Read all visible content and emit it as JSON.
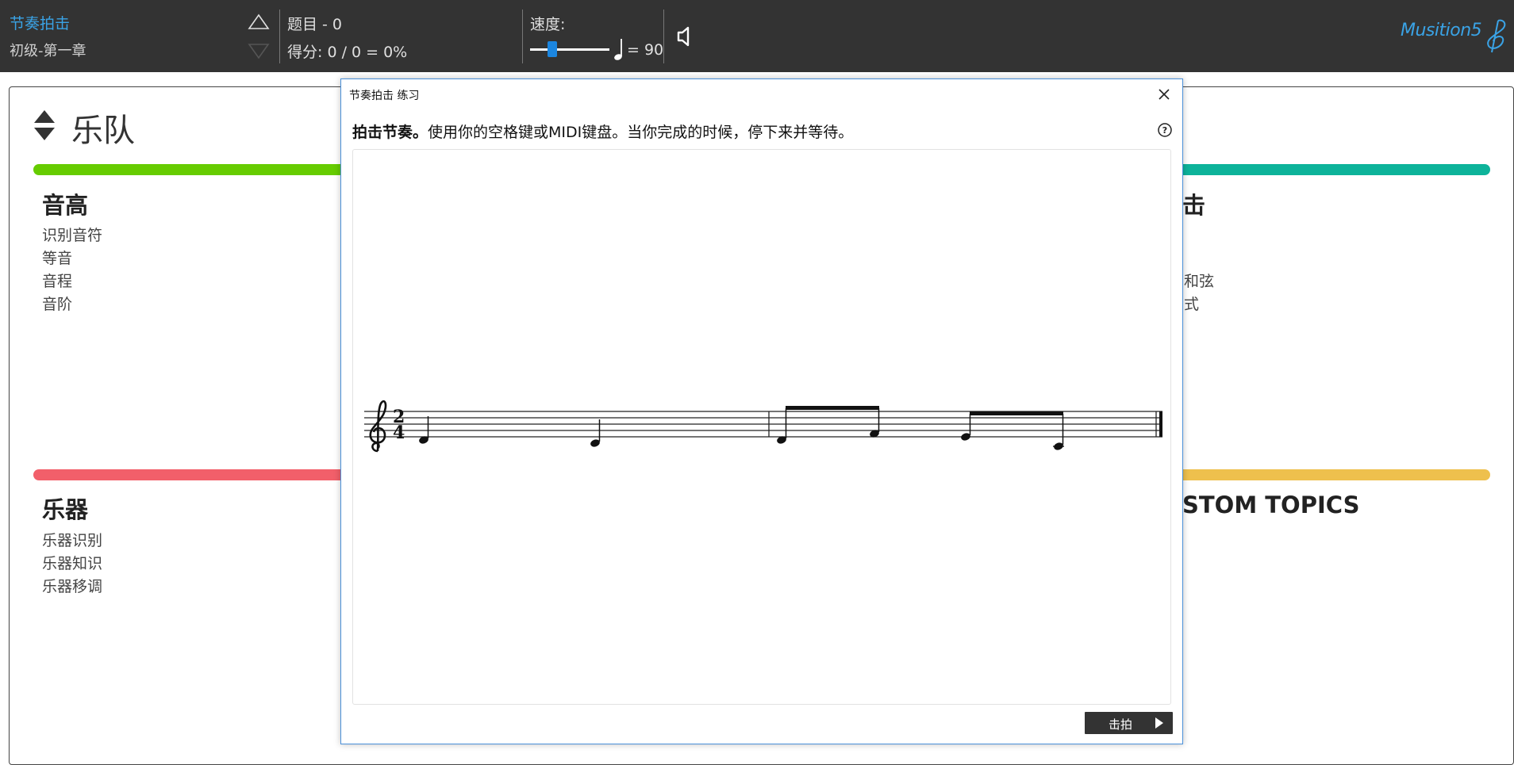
{
  "topbar": {
    "exercise_title": "节奏拍击",
    "exercise_subtitle": "初级-第一章",
    "question_label": "题目 - 0",
    "score_label": "得分: 0 / 0 = 0%",
    "tempo_label": "速度:",
    "tempo_value": "= 90",
    "tempo_slider_fraction": 0.25,
    "brand": "Musition5"
  },
  "background": {
    "ensemble_title": "乐队",
    "categories": [
      {
        "head": "音高",
        "color": "#66cc00",
        "items": [
          "识别音符",
          "等音",
          "音程",
          "音阶"
        ]
      },
      {
        "head": "击",
        "color": "#0db39a",
        "items": [
          "",
          "",
          "和弦",
          "式"
        ]
      },
      {
        "head": "乐器",
        "color": "#f25f6a",
        "items": [
          "乐器识别",
          "乐器知识",
          "乐器移调"
        ]
      },
      {
        "head": "STOM TOPICS",
        "color": "#eec04d",
        "items": []
      }
    ]
  },
  "dialog": {
    "title": "节奏拍击 练习",
    "instruction_bold": "拍击节奏。",
    "instruction_rest": "使用你的空格键或MIDI键盘。当你完成的时候，停下来并等待。",
    "tap_button": "击拍",
    "time_signature": {
      "top": "2",
      "bottom": "4"
    }
  },
  "colors": {
    "topbar": "#333333",
    "accent": "#3aa3e6",
    "slider": "#1b86e0",
    "dialog_border": "#4a90d9"
  },
  "icons": [
    "triangle-up-icon",
    "triangle-down-icon",
    "speaker-icon",
    "quarter-note-icon",
    "close-icon",
    "help-icon",
    "play-icon",
    "sort-arrows-icon",
    "treble-clef-icon"
  ]
}
